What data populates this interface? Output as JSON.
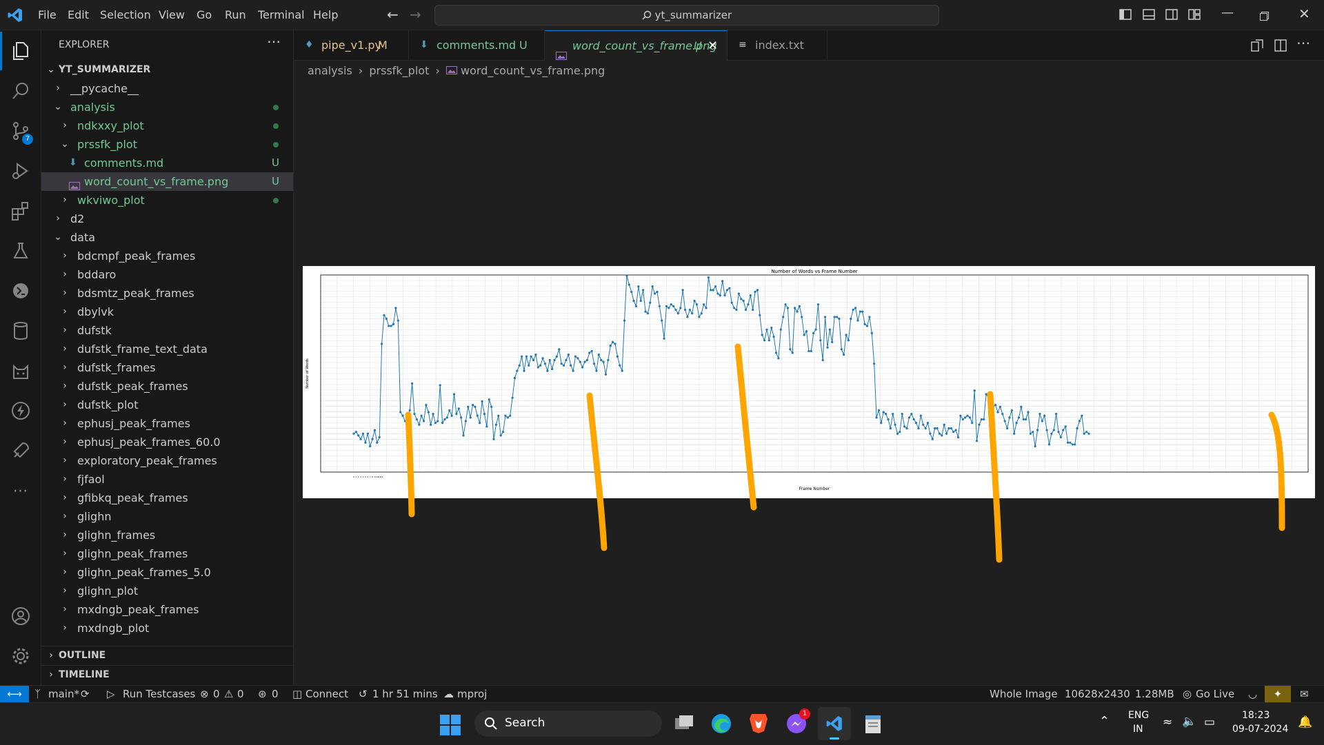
{
  "menu": [
    "File",
    "Edit",
    "Selection",
    "View",
    "Go",
    "Run",
    "Terminal",
    "Help"
  ],
  "search": {
    "text": "yt_summarizer"
  },
  "activity": {
    "scm_badge": "7"
  },
  "explorer": {
    "title": "EXPLORER",
    "root": "YT_SUMMARIZER",
    "items": [
      {
        "label": "__pycache__"
      },
      {
        "label": "analysis"
      },
      {
        "label": "ndkxxy_plot"
      },
      {
        "label": "prssfk_plot"
      },
      {
        "label": "comments.md",
        "badge": "U"
      },
      {
        "label": "word_count_vs_frame.png",
        "badge": "U"
      },
      {
        "label": "wkviwo_plot"
      },
      {
        "label": "d2"
      },
      {
        "label": "data"
      },
      {
        "label": "bdcmpf_peak_frames"
      },
      {
        "label": "bddaro"
      },
      {
        "label": "bdsmtz_peak_frames"
      },
      {
        "label": "dbylvk"
      },
      {
        "label": "dufstk"
      },
      {
        "label": "dufstk_frame_text_data"
      },
      {
        "label": "dufstk_frames"
      },
      {
        "label": "dufstk_peak_frames"
      },
      {
        "label": "dufstk_plot"
      },
      {
        "label": "ephusj_peak_frames"
      },
      {
        "label": "ephusj_peak_frames_60.0"
      },
      {
        "label": "exploratory_peak_frames"
      },
      {
        "label": "fjfaol"
      },
      {
        "label": "gfibkq_peak_frames"
      },
      {
        "label": "glighn"
      },
      {
        "label": "glighn_frames"
      },
      {
        "label": "glighn_peak_frames"
      },
      {
        "label": "glighn_peak_frames_5.0"
      },
      {
        "label": "glighn_plot"
      },
      {
        "label": "mxdngb_peak_frames"
      },
      {
        "label": "mxdngb_plot"
      }
    ],
    "outline": "OUTLINE",
    "timeline": "TIMELINE"
  },
  "tabs": [
    {
      "label": "pipe_v1.py",
      "status": "M"
    },
    {
      "label": "comments.md",
      "status": "U"
    },
    {
      "label": "word_count_vs_frame.png",
      "status": "U"
    },
    {
      "label": "index.txt",
      "status": ""
    }
  ],
  "breadcrumb": [
    "analysis",
    "prssfk_plot",
    "word_count_vs_frame.png"
  ],
  "chart_data": {
    "type": "line",
    "title": "Number of Words vs Frame Number",
    "xlabel": "Frame Number",
    "ylabel": "Number of Words",
    "grid": true,
    "values": [
      21,
      22,
      20,
      18,
      21,
      16,
      21,
      14,
      18,
      23,
      16,
      19,
      71,
      87,
      85,
      81,
      81,
      82,
      91,
      84,
      33,
      31,
      28,
      30,
      34,
      49,
      32,
      29,
      26,
      31,
      28,
      37,
      33,
      26,
      32,
      27,
      28,
      48,
      27,
      29,
      30,
      34,
      31,
      43,
      32,
      35,
      30,
      20,
      28,
      36,
      30,
      37,
      36,
      31,
      27,
      39,
      32,
      25,
      40,
      36,
      18,
      26,
      31,
      20,
      22,
      31,
      30,
      31,
      41,
      52,
      56,
      59,
      64,
      56,
      64,
      59,
      64,
      62,
      65,
      58,
      59,
      63,
      60,
      56,
      62,
      57,
      62,
      64,
      68,
      60,
      59,
      62,
      65,
      59,
      56,
      64,
      63,
      61,
      58,
      61,
      62,
      66,
      67,
      60,
      56,
      65,
      62,
      61,
      54,
      62,
      70,
      72,
      71,
      64,
      59,
      56,
      84,
      109,
      104,
      100,
      95,
      92,
      103,
      95,
      101,
      89,
      88,
      94,
      103,
      99,
      100,
      92,
      84,
      74,
      92,
      91,
      93,
      92,
      90,
      88,
      91,
      101,
      90,
      86,
      90,
      88,
      95,
      93,
      86,
      88,
      93,
      91,
      108,
      101,
      101,
      103,
      99,
      98,
      106,
      98,
      101,
      102,
      94,
      91,
      90,
      99,
      96,
      95,
      90,
      93,
      98,
      90,
      100,
      101,
      87,
      76,
      73,
      79,
      73,
      80,
      75,
      66,
      63,
      79,
      86,
      93,
      91,
      68,
      66,
      91,
      89,
      92,
      86,
      76,
      78,
      67,
      67,
      77,
      79,
      93,
      73,
      62,
      86,
      69,
      79,
      72,
      86,
      86,
      85,
      68,
      65,
      76,
      73,
      85,
      90,
      91,
      84,
      89,
      89,
      82,
      81,
      86,
      77,
      60,
      30,
      34,
      27,
      33,
      32,
      29,
      24,
      32,
      26,
      21,
      22,
      32,
      25,
      24,
      30,
      32,
      29,
      27,
      24,
      31,
      26,
      24,
      27,
      21,
      18,
      24,
      24,
      21,
      20,
      26,
      21,
      24,
      24,
      22,
      23,
      19,
      31,
      29,
      30,
      31,
      30,
      27,
      45,
      17,
      26,
      29,
      29,
      43,
      41,
      38,
      36,
      37,
      33,
      36,
      32,
      28,
      24,
      30,
      34,
      21,
      27,
      30,
      36,
      29,
      29,
      33,
      21,
      22,
      14,
      23,
      32,
      28,
      31,
      23,
      15,
      21,
      23,
      32,
      22,
      19,
      23,
      25,
      16,
      16,
      15,
      15,
      24,
      28,
      31,
      21,
      22,
      21
    ],
    "xtick_labels": [
      "0",
      "1",
      "2",
      "3",
      "4",
      "5",
      "6",
      "7",
      "8",
      "9",
      "10",
      "11",
      "12"
    ]
  },
  "status": {
    "branch": "main*",
    "run_tests": "Run Testcases",
    "errors": "0",
    "warnings": "0",
    "ports": "0",
    "connect": "Connect",
    "time": "1 hr 51 mins",
    "project": "mproj",
    "whole_image": "Whole Image",
    "dims": "10628x2430",
    "size": "1.28MB",
    "golive": "Go Live"
  },
  "taskbar": {
    "search": "Search",
    "lang1": "ENG",
    "lang2": "IN",
    "time": "18:23",
    "date": "09-07-2024",
    "messenger_badge": "1"
  },
  "colors": {
    "accent": "#0078d4",
    "line": "#1f77b4",
    "annotation": "#ffa500",
    "untracked": "#73c991"
  }
}
